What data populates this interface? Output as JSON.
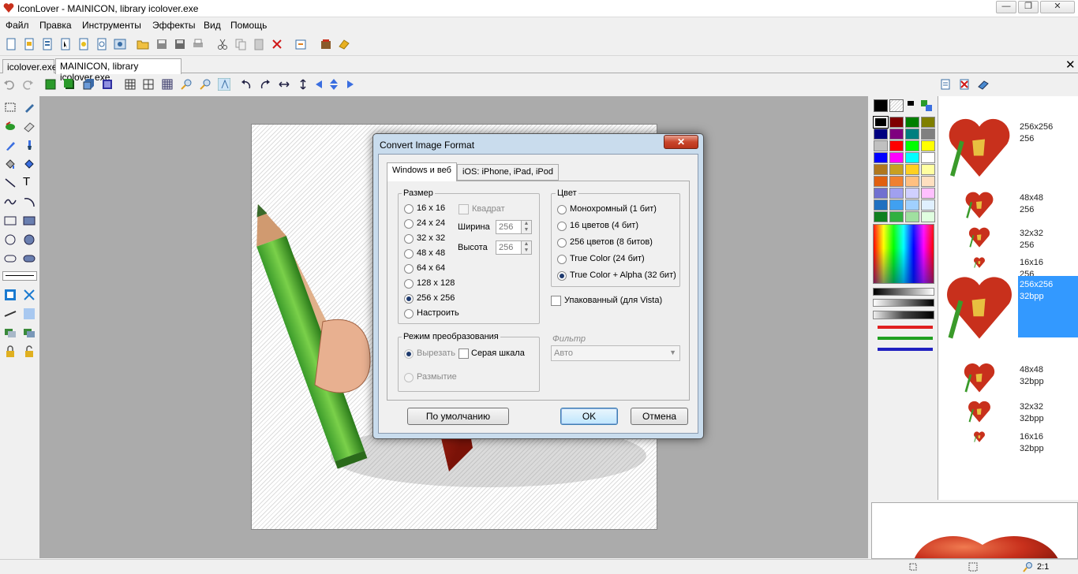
{
  "window": {
    "title": "IconLover - MAINICON, library icolover.exe",
    "minimize": "—",
    "maximize": "❐",
    "close": "✕"
  },
  "menu": [
    "Файл",
    "Правка",
    "Инструменты",
    "Эффекты",
    "Вид",
    "Помощь"
  ],
  "tabs": [
    {
      "label": "icolover.exe"
    },
    {
      "label": "MAINICON, library icolover.exe"
    }
  ],
  "tabs_close": "✕",
  "icon_list": [
    {
      "size": "256x256",
      "bpp": "256"
    },
    {
      "size": "48x48",
      "bpp": "256"
    },
    {
      "size": "32x32",
      "bpp": "256"
    },
    {
      "size": "16x16",
      "bpp": "256"
    },
    {
      "size": "256x256",
      "bpp": "32bpp"
    },
    {
      "size": "48x48",
      "bpp": "32bpp"
    },
    {
      "size": "32x32",
      "bpp": "32bpp"
    },
    {
      "size": "16x16",
      "bpp": "32bpp"
    }
  ],
  "status": {
    "zoom": "2:1"
  },
  "colors": {
    "selection": "#3399ff",
    "accent": "#3c7fb1",
    "heart": "#c8301c"
  },
  "dialog": {
    "title": "Convert Image Format",
    "close": "✕",
    "tabs": [
      "Windows и веб",
      "iOS: iPhone, iPad, iPod"
    ],
    "size_group": "Размер",
    "sizes": [
      "16 x 16",
      "24 x 24",
      "32 x 32",
      "48 x 48",
      "64 x 64",
      "128 x 128",
      "256 x 256",
      "Настроить"
    ],
    "size_selected": "256 x 256",
    "square_label": "Квадрат",
    "width_label": "Ширина",
    "width_value": "256",
    "height_label": "Высота",
    "height_value": "256",
    "color_group": "Цвет",
    "colors": [
      "Монохромный (1 бит)",
      "16 цветов (4 бит)",
      "256 цветов (8 битов)",
      "True Color (24 бит)",
      "True Color + Alpha (32 бит)"
    ],
    "color_selected": "True Color + Alpha (32 бит)",
    "packed_label": "Упакованный (для Vista)",
    "mode_group": "Режим преобразования",
    "mode_cut": "Вырезать",
    "mode_gray": "Серая шкала",
    "mode_blur": "Размытие",
    "filter_label": "Фильтр",
    "filter_value": "Авто",
    "btn_default": "По умолчанию",
    "btn_ok": "OK",
    "btn_cancel": "Отмена"
  }
}
